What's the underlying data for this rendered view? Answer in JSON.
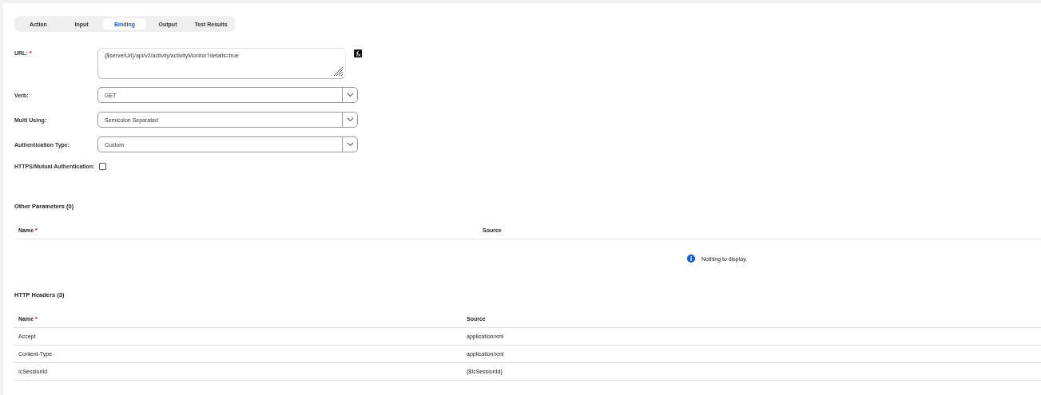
{
  "tabs": [
    {
      "label": "Action",
      "selected": false
    },
    {
      "label": "Input",
      "selected": false
    },
    {
      "label": "Binding",
      "selected": true
    },
    {
      "label": "Output",
      "selected": false
    },
    {
      "label": "Test Results",
      "selected": false
    }
  ],
  "form": {
    "url": {
      "label": "URL:",
      "required_mark": "*",
      "value": "{$serverUrl}/api/v2/activity/activityMonitor?details=true"
    },
    "selects": [
      {
        "label": "Verb:",
        "value": "GET"
      },
      {
        "label": "Multi Using:",
        "value": "Semicolon Separated"
      },
      {
        "label": "Authentication Type:",
        "value": "Custom"
      }
    ],
    "mutual_auth": {
      "label": "HTTPS/Mutual Authentication:",
      "checked": false
    }
  },
  "other_parameters": {
    "title": "Other Parameters (0)",
    "columns": [
      {
        "label": "Name",
        "required_mark": "*"
      },
      {
        "label": "Source"
      }
    ],
    "empty_message": "Nothing to display."
  },
  "http_headers": {
    "title": "HTTP Headers (3)",
    "columns": [
      {
        "label": "Name",
        "required_mark": "*"
      },
      {
        "label": "Source"
      }
    ],
    "rows": [
      [
        "Accept",
        "application/xml"
      ],
      [
        "Content-Type",
        "application/xml"
      ],
      [
        "IcSessionId",
        "{$IcSessionId}"
      ]
    ]
  }
}
